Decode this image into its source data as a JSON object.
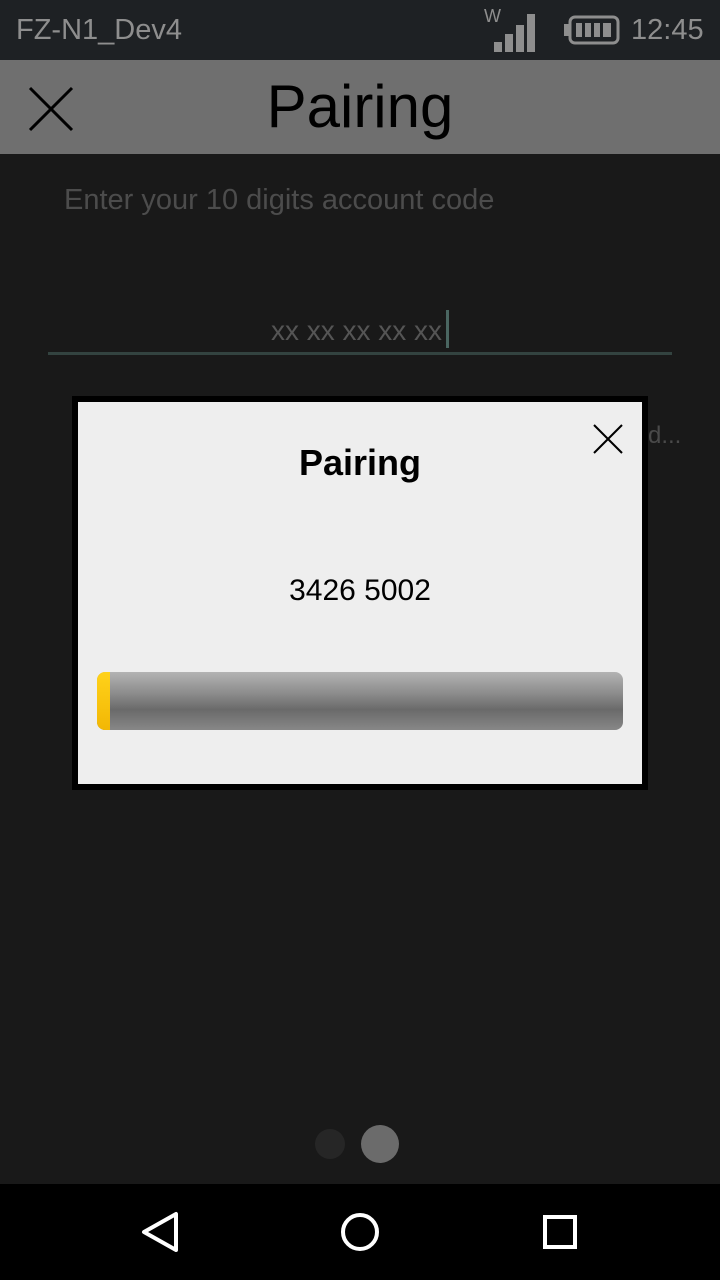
{
  "status_bar": {
    "title": "FZ-N1_Dev4",
    "network_badge": "W",
    "time": "12:45",
    "icons": [
      "signal-icon",
      "battery-icon"
    ]
  },
  "app_bar": {
    "title": "Pairing",
    "close_icon": "close-icon"
  },
  "form": {
    "instruction": "Enter your 10 digits account code",
    "code_placeholder": "xx xx xx xx xx",
    "truncated_text": "d..."
  },
  "modal": {
    "title": "Pairing",
    "code": "3426 5002",
    "progress": 0.025,
    "close_icon": "close-icon"
  },
  "pager": {
    "page_count": 2,
    "active_index": 1
  },
  "nav_bar": {
    "buttons": [
      "back-icon",
      "home-icon",
      "recents-icon"
    ]
  },
  "colors": {
    "background": "#191919",
    "status_bar": "#1e2124",
    "app_bar": "#6f6f6f",
    "modal_background": "#eeeeee",
    "progress_fill": "#f7c300",
    "input_underline": "#334340"
  }
}
